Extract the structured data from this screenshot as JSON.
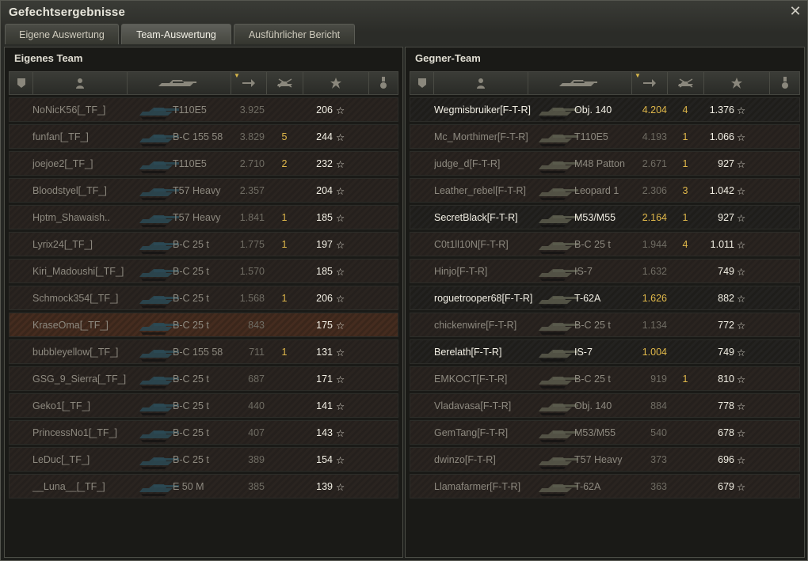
{
  "window": {
    "title": "Gefechtsergebnisse",
    "close_icon": "close-icon"
  },
  "tabs": [
    {
      "label": "Eigene Auswertung",
      "active": false
    },
    {
      "label": "Team-Auswertung",
      "active": true
    },
    {
      "label": "Ausführlicher Bericht",
      "active": false
    }
  ],
  "columns": {
    "icons": [
      "platoon-icon",
      "player-icon",
      "tank-icon",
      "damage-icon",
      "kills-icon",
      "experience-star-icon",
      "medal-icon"
    ],
    "sorted_column": "damage"
  },
  "own_team": {
    "title": "Eigenes Team",
    "rows": [
      {
        "player": "NoNicK56[_TF_]",
        "tank": "T110E5",
        "damage": "3.925",
        "kills": "",
        "xp": "206",
        "highlight": false
      },
      {
        "player": "funfan[_TF_]",
        "tank": "B-C 155 58",
        "damage": "3.829",
        "kills": "5",
        "xp": "244",
        "highlight": false
      },
      {
        "player": "joejoe2[_TF_]",
        "tank": "T110E5",
        "damage": "2.710",
        "kills": "2",
        "xp": "232",
        "highlight": false
      },
      {
        "player": "Bloodstyel[_TF_]",
        "tank": "T57 Heavy",
        "damage": "2.357",
        "kills": "",
        "xp": "204",
        "highlight": false
      },
      {
        "player": "Hptm_Shawaish..",
        "tank": "T57 Heavy",
        "damage": "1.841",
        "kills": "1",
        "xp": "185",
        "highlight": false
      },
      {
        "player": "Lyrix24[_TF_]",
        "tank": "B-C 25 t",
        "damage": "1.775",
        "kills": "1",
        "xp": "197",
        "highlight": false
      },
      {
        "player": "Kiri_Madoushi[_TF_]",
        "tank": "B-C 25 t",
        "damage": "1.570",
        "kills": "",
        "xp": "185",
        "highlight": false
      },
      {
        "player": "Schmock354[_TF_]",
        "tank": "B-C 25 t",
        "damage": "1.568",
        "kills": "1",
        "xp": "206",
        "highlight": false
      },
      {
        "player": "KraseOma[_TF_]",
        "tank": "B-C 25 t",
        "damage": "843",
        "kills": "",
        "xp": "175",
        "highlight": true
      },
      {
        "player": "bubbleyellow[_TF_]",
        "tank": "B-C 155 58",
        "damage": "711",
        "kills": "1",
        "xp": "131",
        "highlight": false
      },
      {
        "player": "GSG_9_Sierra[_TF_]",
        "tank": "B-C 25 t",
        "damage": "687",
        "kills": "",
        "xp": "171",
        "highlight": false
      },
      {
        "player": "Geko1[_TF_]",
        "tank": "B-C 25 t",
        "damage": "440",
        "kills": "",
        "xp": "141",
        "highlight": false
      },
      {
        "player": "PrincessNo1[_TF_]",
        "tank": "B-C 25 t",
        "damage": "407",
        "kills": "",
        "xp": "143",
        "highlight": false
      },
      {
        "player": "LeDuc[_TF_]",
        "tank": "B-C 25 t",
        "damage": "389",
        "kills": "",
        "xp": "154",
        "highlight": false
      },
      {
        "player": "__Luna__[_TF_]",
        "tank": "E 50 M",
        "damage": "385",
        "kills": "",
        "xp": "139",
        "highlight": false
      }
    ]
  },
  "enemy_team": {
    "title": "Gegner-Team",
    "rows": [
      {
        "player": "Wegmisbruiker[F-T-R]",
        "tank": "Obj. 140",
        "damage": "4.204",
        "kills": "4",
        "xp": "1.376",
        "alive": true
      },
      {
        "player": "Mc_Morthimer[F-T-R]",
        "tank": "T110E5",
        "damage": "4.193",
        "kills": "1",
        "xp": "1.066",
        "alive": false
      },
      {
        "player": "judge_d[F-T-R]",
        "tank": "M48 Patton",
        "damage": "2.671",
        "kills": "1",
        "xp": "927",
        "alive": false
      },
      {
        "player": "Leather_rebel[F-T-R]",
        "tank": "Leopard 1",
        "damage": "2.306",
        "kills": "3",
        "xp": "1.042",
        "alive": false
      },
      {
        "player": "SecretBlack[F-T-R]",
        "tank": "M53/M55",
        "damage": "2.164",
        "kills": "1",
        "xp": "927",
        "alive": true
      },
      {
        "player": "C0t1ll10N[F-T-R]",
        "tank": "B-C 25 t",
        "damage": "1.944",
        "kills": "4",
        "xp": "1.011",
        "alive": false
      },
      {
        "player": "Hinjo[F-T-R]",
        "tank": "IS-7",
        "damage": "1.632",
        "kills": "",
        "xp": "749",
        "alive": false
      },
      {
        "player": "roguetrooper68[F-T-R]",
        "tank": "T-62A",
        "damage": "1.626",
        "kills": "",
        "xp": "882",
        "alive": true
      },
      {
        "player": "chickenwire[F-T-R]",
        "tank": "B-C 25 t",
        "damage": "1.134",
        "kills": "",
        "xp": "772",
        "alive": false
      },
      {
        "player": "Berelath[F-T-R]",
        "tank": "IS-7",
        "damage": "1.004",
        "kills": "",
        "xp": "749",
        "alive": true
      },
      {
        "player": "EMKOCT[F-T-R]",
        "tank": "B-C 25 t",
        "damage": "919",
        "kills": "1",
        "xp": "810",
        "alive": false
      },
      {
        "player": "Vladavasa[F-T-R]",
        "tank": "Obj. 140",
        "damage": "884",
        "kills": "",
        "xp": "778",
        "alive": false
      },
      {
        "player": "GemTang[F-T-R]",
        "tank": "M53/M55",
        "damage": "540",
        "kills": "",
        "xp": "678",
        "alive": false
      },
      {
        "player": "dwinzo[F-T-R]",
        "tank": "T57 Heavy",
        "damage": "373",
        "kills": "",
        "xp": "696",
        "alive": false
      },
      {
        "player": "Llamafarmer[F-T-R]",
        "tank": "T-62A",
        "damage": "363",
        "kills": "",
        "xp": "679",
        "alive": false
      }
    ]
  },
  "colors": {
    "alive_text": "#f2efe4",
    "dead_text": "#8d897f",
    "damage_alive": "#e0b84a",
    "kills": "#e0b84a",
    "own_tank_tint": "#2b4a55",
    "enemy_tank_tint": "#5a5b4c"
  }
}
